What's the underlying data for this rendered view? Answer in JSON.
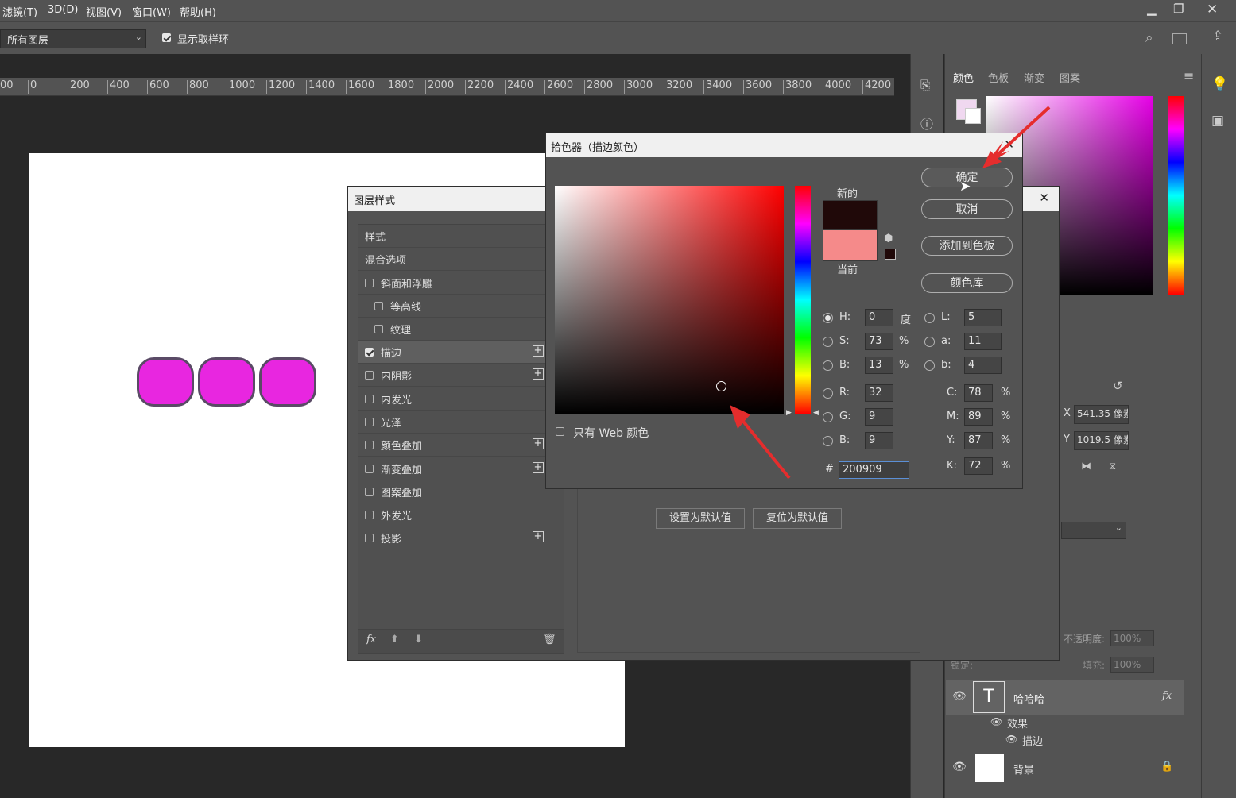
{
  "menu": {
    "items": [
      "滤镜(T)",
      "3D(D)",
      "视图(V)",
      "窗口(W)",
      "帮助(H)"
    ]
  },
  "options_bar": {
    "sample_select": "所有图层",
    "show_ring_label": "显示取样环",
    "show_ring_checked": true
  },
  "ruler": {
    "ticks": [
      "00",
      "0",
      "200",
      "400",
      "600",
      "800",
      "1000",
      "1200",
      "1400",
      "1600",
      "1800",
      "2000",
      "2200",
      "2400",
      "2600",
      "2800",
      "3000",
      "3200",
      "3400",
      "3600",
      "3800",
      "4000",
      "4200"
    ]
  },
  "color_panel": {
    "tabs": [
      "颜色",
      "色板",
      "渐变",
      "图案"
    ],
    "active_tab": "颜色"
  },
  "layer_style": {
    "title": "图层样式",
    "header": "样式",
    "blend_options": "混合选项",
    "items": [
      {
        "label": "斜面和浮雕",
        "checked": false,
        "plus": false,
        "indent": false
      },
      {
        "label": "等高线",
        "checked": false,
        "plus": false,
        "indent": true
      },
      {
        "label": "纹理",
        "checked": false,
        "plus": false,
        "indent": true
      },
      {
        "label": "描边",
        "checked": true,
        "plus": true,
        "indent": false
      },
      {
        "label": "内阴影",
        "checked": false,
        "plus": true,
        "indent": false
      },
      {
        "label": "内发光",
        "checked": false,
        "plus": false,
        "indent": false
      },
      {
        "label": "光泽",
        "checked": false,
        "plus": false,
        "indent": false
      },
      {
        "label": "颜色叠加",
        "checked": false,
        "plus": true,
        "indent": false
      },
      {
        "label": "渐变叠加",
        "checked": false,
        "plus": true,
        "indent": false
      },
      {
        "label": "图案叠加",
        "checked": false,
        "plus": false,
        "indent": false
      },
      {
        "label": "外发光",
        "checked": false,
        "plus": false,
        "indent": false
      },
      {
        "label": "投影",
        "checked": false,
        "plus": true,
        "indent": false
      }
    ],
    "fx_label": "fx",
    "set_default": "设置为默认值",
    "reset_default": "复位为默认值",
    "stroke_active": true
  },
  "color_picker": {
    "title": "拾色器（描边颜色）",
    "ok": "确定",
    "cancel": "取消",
    "add_swatch": "添加到色板",
    "color_library": "颜色库",
    "new_label": "新的",
    "current_label": "当前",
    "new_color": "#200909",
    "current_color": "#f58a8a",
    "web_only_label": "只有 Web 颜色",
    "hsb": {
      "h_label": "H:",
      "h": "0",
      "h_unit": "度",
      "s_label": "S:",
      "s": "73",
      "s_unit": "%",
      "b_label": "B:",
      "b": "13",
      "b_unit": "%"
    },
    "rgb": {
      "r_label": "R:",
      "r": "32",
      "g_label": "G:",
      "g": "9",
      "b_label": "B:",
      "b": "9"
    },
    "lab": {
      "l_label": "L:",
      "l": "5",
      "a_label": "a:",
      "a": "11",
      "b_label": "b:",
      "b": "4"
    },
    "cmyk": {
      "c_label": "C:",
      "c": "78",
      "m_label": "M:",
      "m": "89",
      "y_label": "Y:",
      "y": "87",
      "k_label": "K:",
      "k": "72",
      "unit": "%"
    },
    "hex_label": "#",
    "hex": "200909"
  },
  "properties": {
    "x_label": "X",
    "x_value": "541.35 像素",
    "y_label": "Y",
    "y_value": "1019.5 像素"
  },
  "layers_panel": {
    "opacity_label": "不透明度:",
    "opacity_value": "100%",
    "lock_label": "锁定:",
    "fill_label": "填充:",
    "fill_value": "100%",
    "text_layer_name": "哈哈哈",
    "fx": "fx",
    "effects_label": "效果",
    "stroke_effect_label": "描边",
    "background_layer_name": "背景"
  }
}
